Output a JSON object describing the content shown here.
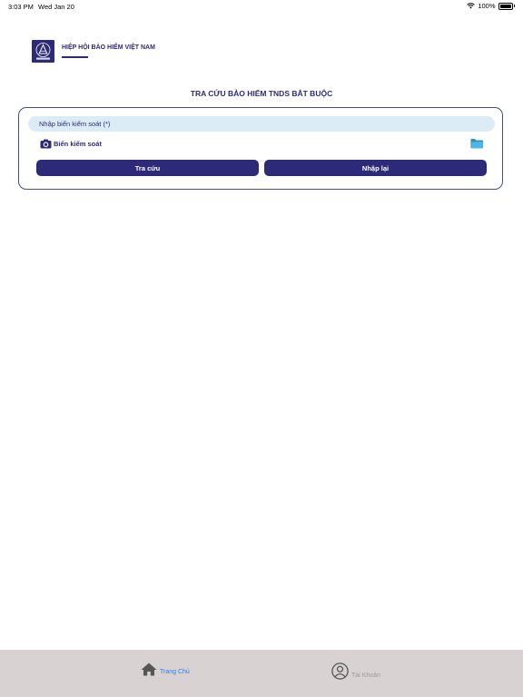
{
  "status_bar": {
    "time": "3:03 PM",
    "date": "Wed Jan 20",
    "battery": "100%"
  },
  "header": {
    "org_name": "HIỆP HỘI BẢO HIỂM VIỆT NAM",
    "logo_caption": "IAV"
  },
  "page": {
    "title": "TRA CỨU BẢO HIỂM TNDS BẮT BUỘC"
  },
  "form": {
    "plate_placeholder": "Nhập biển kiểm soát (*)",
    "plate_value": "",
    "camera_label": "Biển kiểm soát",
    "search_button": "Tra cứu",
    "reset_button": "Nhập lại"
  },
  "tabs": [
    {
      "label": "Trang Chủ",
      "active": true,
      "icon": "home-icon"
    },
    {
      "label": "Tài Khoản",
      "active": false,
      "icon": "account-icon"
    }
  ],
  "colors": {
    "brand": "#2e2a7a",
    "input_bg": "#dcecf7",
    "tab_active": "#2d7cf6",
    "tab_bar": "#d9d2d2",
    "folder": "#4fb6e0"
  }
}
